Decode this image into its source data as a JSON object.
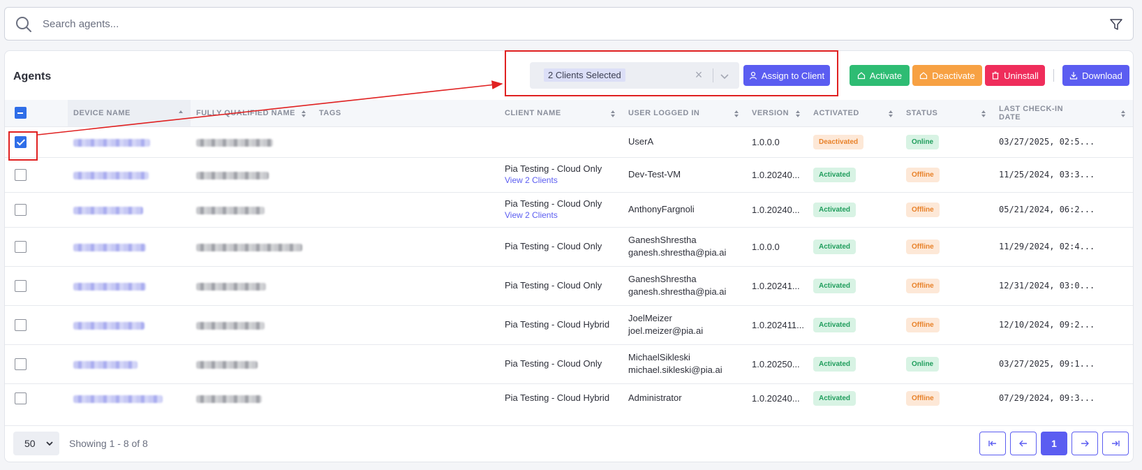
{
  "search": {
    "placeholder": "Search agents..."
  },
  "card": {
    "title": "Agents"
  },
  "client_select": {
    "value": "2 Clients Selected",
    "clear_glyph": "×"
  },
  "toolbar": {
    "assign": "Assign to Client",
    "activate": "Activate",
    "deactivate": "Deactivate",
    "uninstall": "Uninstall",
    "download": "Download"
  },
  "columns": {
    "device_name": "DEVICE NAME",
    "fqdn": "FULLY QUALIFIED NAME",
    "tags": "TAGS",
    "client_name": "CLIENT NAME",
    "user": "USER LOGGED IN",
    "version": "VERSION",
    "activated": "ACTIVATED",
    "status": "STATUS",
    "last_checkin": "LAST CHECK-IN DATE"
  },
  "rows": [
    {
      "checked": true,
      "client": "",
      "client_link": "",
      "user": "UserA",
      "email": "",
      "version": "1.0.0.0",
      "activated": "Deactivated",
      "status": "Online",
      "checkin": "03/27/2025, 02:5..."
    },
    {
      "checked": false,
      "client": "Pia Testing - Cloud Only",
      "client_link": "View 2 Clients",
      "user": "Dev-Test-VM",
      "email": "",
      "version": "1.0.20240...",
      "activated": "Activated",
      "status": "Offline",
      "checkin": "11/25/2024, 03:3..."
    },
    {
      "checked": false,
      "client": "Pia Testing - Cloud Only",
      "client_link": "View 2 Clients",
      "user": "AnthonyFargnoli",
      "email": "",
      "version": "1.0.20240...",
      "activated": "Activated",
      "status": "Offline",
      "checkin": "05/21/2024, 06:2..."
    },
    {
      "checked": false,
      "client": "Pia Testing - Cloud Only",
      "client_link": "",
      "user": "GaneshShrestha",
      "email": "ganesh.shrestha@pia.ai",
      "version": "1.0.0.0",
      "activated": "Activated",
      "status": "Offline",
      "checkin": "11/29/2024, 02:4..."
    },
    {
      "checked": false,
      "client": "Pia Testing - Cloud Only",
      "client_link": "",
      "user": "GaneshShrestha",
      "email": "ganesh.shrestha@pia.ai",
      "version": "1.0.20241...",
      "activated": "Activated",
      "status": "Offline",
      "checkin": "12/31/2024, 03:0..."
    },
    {
      "checked": false,
      "client": "Pia Testing - Cloud Hybrid",
      "client_link": "",
      "user": "JoelMeizer",
      "email": "joel.meizer@pia.ai",
      "version": "1.0.202411...",
      "activated": "Activated",
      "status": "Offline",
      "checkin": "12/10/2024, 09:2..."
    },
    {
      "checked": false,
      "client": "Pia Testing - Cloud Only",
      "client_link": "",
      "user": "MichaelSikleski",
      "email": "michael.sikleski@pia.ai",
      "version": "1.0.20250...",
      "activated": "Activated",
      "status": "Online",
      "checkin": "03/27/2025, 09:1..."
    },
    {
      "checked": false,
      "client": "Pia Testing - Cloud Hybrid",
      "client_link": "",
      "user": "Administrator",
      "email": "",
      "version": "1.0.20240...",
      "activated": "Activated",
      "status": "Offline",
      "checkin": "07/29/2024, 09:3..."
    }
  ],
  "footer": {
    "per_page": "50",
    "showing": "Showing 1 - 8 of 8",
    "current_page": "1"
  },
  "colors": {
    "primary": "#5b5df1",
    "success": "#2ebc73",
    "warning": "#f7a143",
    "danger": "#ef2d5b",
    "annotation": "#e02121"
  }
}
